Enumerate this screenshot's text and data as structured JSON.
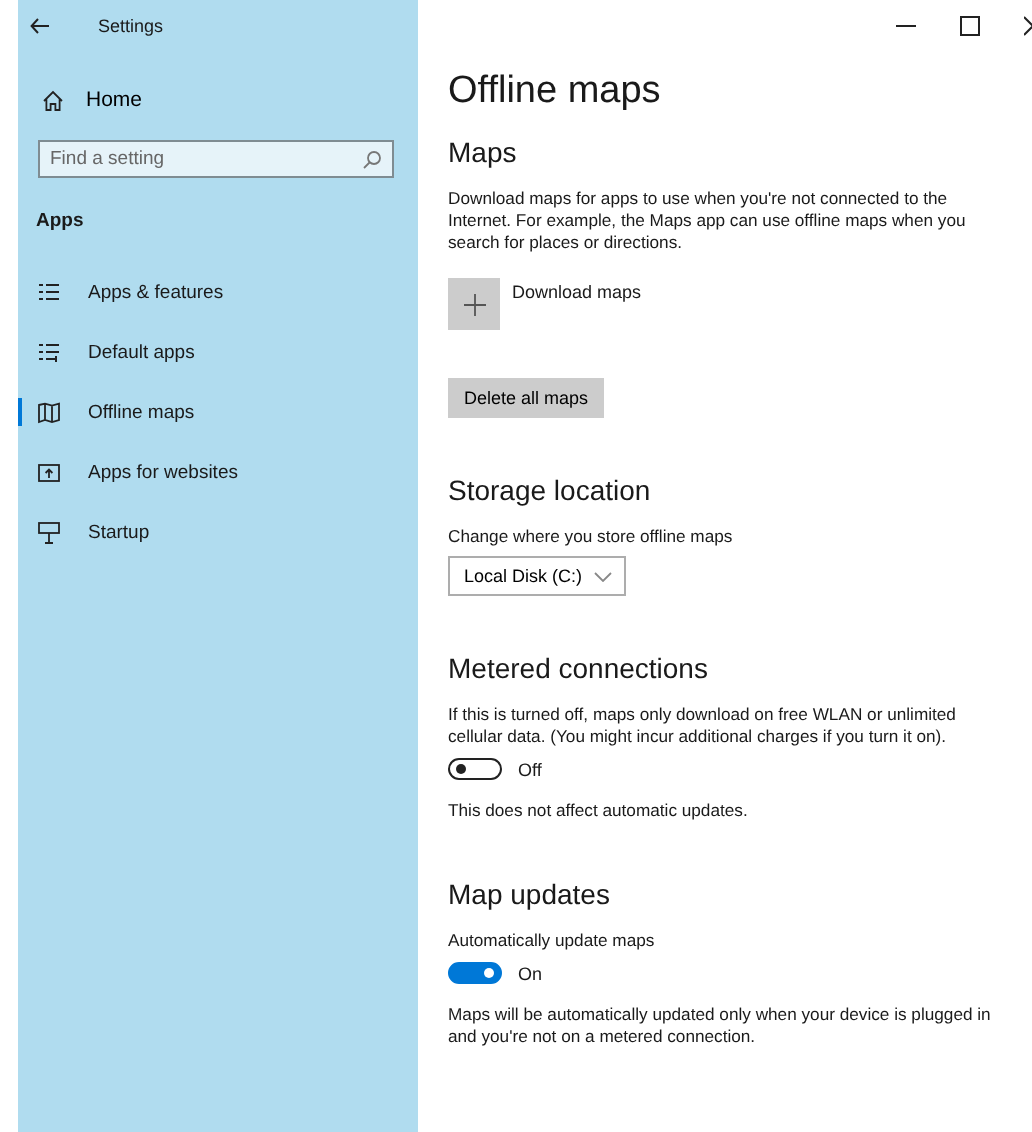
{
  "window": {
    "title": "Settings"
  },
  "sidebar": {
    "home": "Home",
    "search": {
      "placeholder": "Find a setting"
    },
    "section": "Apps",
    "items": [
      {
        "label": "Apps & features",
        "selected": false
      },
      {
        "label": "Default apps",
        "selected": false
      },
      {
        "label": "Offline maps",
        "selected": true
      },
      {
        "label": "Apps for websites",
        "selected": false
      },
      {
        "label": "Startup",
        "selected": false
      }
    ]
  },
  "page": {
    "title": "Offline maps",
    "sections": [
      {
        "heading": "Maps",
        "blocks": [
          {
            "kind": "text",
            "text": "Download maps for apps to use when you're not connected to the Internet. For example, the Maps app can use offline maps when you search for places or directions."
          },
          {
            "kind": "add_button",
            "label": "Download maps"
          },
          {
            "kind": "button",
            "label": "Delete all maps"
          }
        ]
      },
      {
        "heading": "Storage location",
        "blocks": [
          {
            "kind": "text",
            "text": "Change where you store offline maps"
          },
          {
            "kind": "dropdown",
            "value": "Local Disk (C:)"
          }
        ]
      },
      {
        "heading": "Metered connections",
        "blocks": [
          {
            "kind": "text",
            "text": "If this is turned off, maps only download on free WLAN or unlimited cellular data. (You might incur additional charges if you turn it on)."
          },
          {
            "kind": "toggle",
            "on": false,
            "label": "Off"
          },
          {
            "kind": "text",
            "text": "This does not affect automatic updates."
          }
        ]
      },
      {
        "heading": "Map updates",
        "blocks": [
          {
            "kind": "text",
            "text": "Automatically update maps"
          },
          {
            "kind": "toggle",
            "on": true,
            "label": "On"
          },
          {
            "kind": "text",
            "text": "Maps will be automatically updated only when your device is plugged in and you're not on a metered connection."
          }
        ]
      }
    ]
  }
}
